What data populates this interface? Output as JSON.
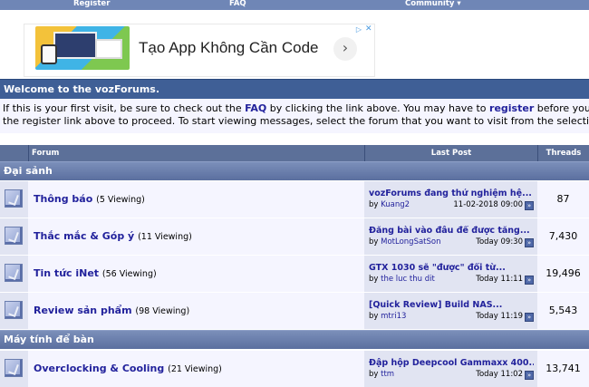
{
  "nav": {
    "register": "Register",
    "faq": "FAQ",
    "community": "Community",
    "community_arrow": "▾"
  },
  "ad": {
    "title": "Tạo App Không Cần Code",
    "arrow_icon": "chevron-right-icon",
    "arrow_glyph": "›",
    "info_glyph": "▷",
    "close_glyph": "✕"
  },
  "welcome": {
    "title": "Welcome to the vozForums.",
    "line1_pre": "If this is your first visit, be sure to check out the ",
    "line1_faq": "FAQ",
    "line1_mid": " by clicking the link above. You may have to ",
    "line1_register": "register",
    "line1_post": " before you can",
    "line2": "the register link above to proceed. To start viewing messages, select the forum that you want to visit from the selection be"
  },
  "table": {
    "headers": {
      "forum": "Forum",
      "last_post": "Last Post",
      "threads": "Threads"
    }
  },
  "sections": [
    {
      "name": "Đại sảnh",
      "forums": [
        {
          "name": "Thông báo",
          "viewing": "(5 Viewing)",
          "last_title": "vozForums đang thử nghiệm hệ...",
          "last_by": "by",
          "last_user": "Kuang2",
          "last_date": "11-02-2018",
          "last_time": "09:00",
          "threads": "87"
        },
        {
          "name": "Thắc mắc & Góp ý",
          "viewing": "(11 Viewing)",
          "last_title": "Đăng bài vào đâu để được tăng...",
          "last_by": "by",
          "last_user": "MotLongSatSon",
          "last_date": "Today",
          "last_time": "09:30",
          "threads": "7,430"
        },
        {
          "name": "Tin tức iNet",
          "viewing": "(56 Viewing)",
          "last_title": "GTX 1030 sẽ \"được\" đổi từ...",
          "last_by": "by",
          "last_user": "the luc thu dit",
          "last_date": "Today",
          "last_time": "11:11",
          "threads": "19,496"
        },
        {
          "name": "Review sản phẩm",
          "viewing": "(98 Viewing)",
          "last_title": "[Quick Review] Build NAS...",
          "last_by": "by",
          "last_user": "mtri13",
          "last_date": "Today",
          "last_time": "11:19",
          "threads": "5,543"
        }
      ]
    },
    {
      "name": "Máy tính để bàn",
      "forums": [
        {
          "name": "Overclocking & Cooling",
          "viewing": "(21 Viewing)",
          "last_title": "Đập hộp Deepcool Gammaxx 400...",
          "last_by": "by",
          "last_user": "ttm",
          "last_date": "Today",
          "last_time": "11:02",
          "threads": "13,741"
        }
      ]
    }
  ],
  "go_glyph": "»",
  "colors": {
    "nav_bg": "#6f86b6",
    "header_bg": "#3f5f96",
    "link": "#22229c",
    "alt1": "#f5f5ff",
    "alt2": "#e1e4f2"
  }
}
